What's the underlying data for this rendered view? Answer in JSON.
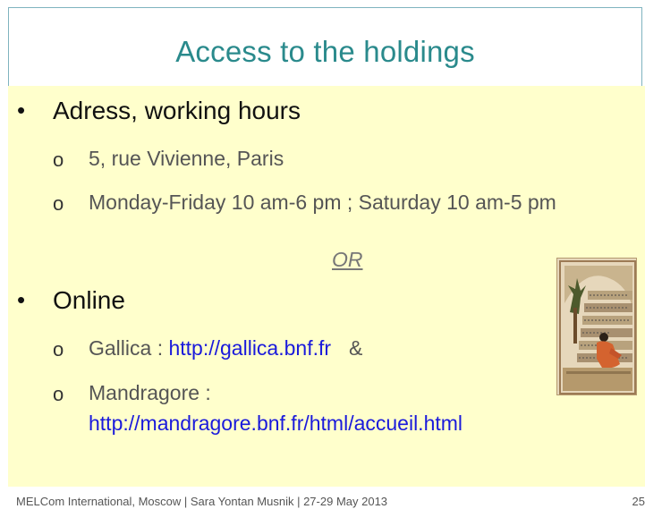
{
  "slide": {
    "title": "Access to the holdings",
    "bullets": [
      {
        "text": "Adress, working hours",
        "subitems": [
          "5, rue Vivienne, Paris",
          "Monday-Friday 10 am-6 pm ; Saturday 10 am-5 pm"
        ]
      },
      {
        "text": "Online",
        "subitems": [
          {
            "label": "Gallica : ",
            "link": "http://gallica.bnf.fr",
            "suffix": "&"
          },
          {
            "label": "Mandragore :",
            "link": "http://mandragore.bnf.fr/html/accueil.html"
          }
        ]
      }
    ],
    "separator": "OR",
    "bullet_symbol": "•",
    "subbullet_symbol": "o"
  },
  "footer": {
    "text": "MELCom International, Moscow | Sara Yontan Musnik | 27-29 May 2013",
    "page_number": "25"
  },
  "colors": {
    "title": "#2a8a8c",
    "content_background": "#ffffcc",
    "link": "#1a1adb"
  }
}
